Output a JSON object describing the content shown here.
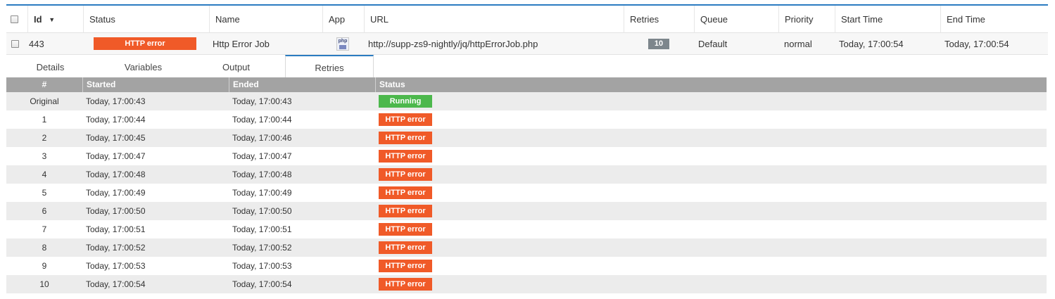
{
  "table": {
    "columns": [
      "Id",
      "Status",
      "Name",
      "App",
      "URL",
      "Retries",
      "Queue",
      "Priority",
      "Start Time",
      "End Time"
    ],
    "sort_indicator": "▼"
  },
  "job": {
    "id": "443",
    "status": "HTTP error",
    "name": "Http Error Job",
    "app_icon": "php-icon",
    "url": "http://supp-zs9-nightly/jq/httpErrorJob.php",
    "retries": "10",
    "queue": "Default",
    "priority": "normal",
    "start_time": "Today, 17:00:54",
    "end_time": "Today, 17:00:54"
  },
  "tabs": [
    "Details",
    "Variables",
    "Output",
    "Retries"
  ],
  "active_tab": "Retries",
  "retries_table": {
    "headers": [
      "#",
      "Started",
      "Ended",
      "Status"
    ],
    "rows": [
      {
        "n": "Original",
        "started": "Today, 17:00:43",
        "ended": "Today, 17:00:43",
        "status": "Running"
      },
      {
        "n": "1",
        "started": "Today, 17:00:44",
        "ended": "Today, 17:00:44",
        "status": "HTTP error"
      },
      {
        "n": "2",
        "started": "Today, 17:00:45",
        "ended": "Today, 17:00:46",
        "status": "HTTP error"
      },
      {
        "n": "3",
        "started": "Today, 17:00:47",
        "ended": "Today, 17:00:47",
        "status": "HTTP error"
      },
      {
        "n": "4",
        "started": "Today, 17:00:48",
        "ended": "Today, 17:00:48",
        "status": "HTTP error"
      },
      {
        "n": "5",
        "started": "Today, 17:00:49",
        "ended": "Today, 17:00:49",
        "status": "HTTP error"
      },
      {
        "n": "6",
        "started": "Today, 17:00:50",
        "ended": "Today, 17:00:50",
        "status": "HTTP error"
      },
      {
        "n": "7",
        "started": "Today, 17:00:51",
        "ended": "Today, 17:00:51",
        "status": "HTTP error"
      },
      {
        "n": "8",
        "started": "Today, 17:00:52",
        "ended": "Today, 17:00:52",
        "status": "HTTP error"
      },
      {
        "n": "9",
        "started": "Today, 17:00:53",
        "ended": "Today, 17:00:53",
        "status": "HTTP error"
      },
      {
        "n": "10",
        "started": "Today, 17:00:54",
        "ended": "Today, 17:00:54",
        "status": "HTTP error"
      }
    ]
  },
  "colors": {
    "accent": "#2b7cc1",
    "error": "#f05a28",
    "running": "#4cb84c",
    "retries_badge": "#7d868c",
    "table_header": "#a3a3a3"
  }
}
